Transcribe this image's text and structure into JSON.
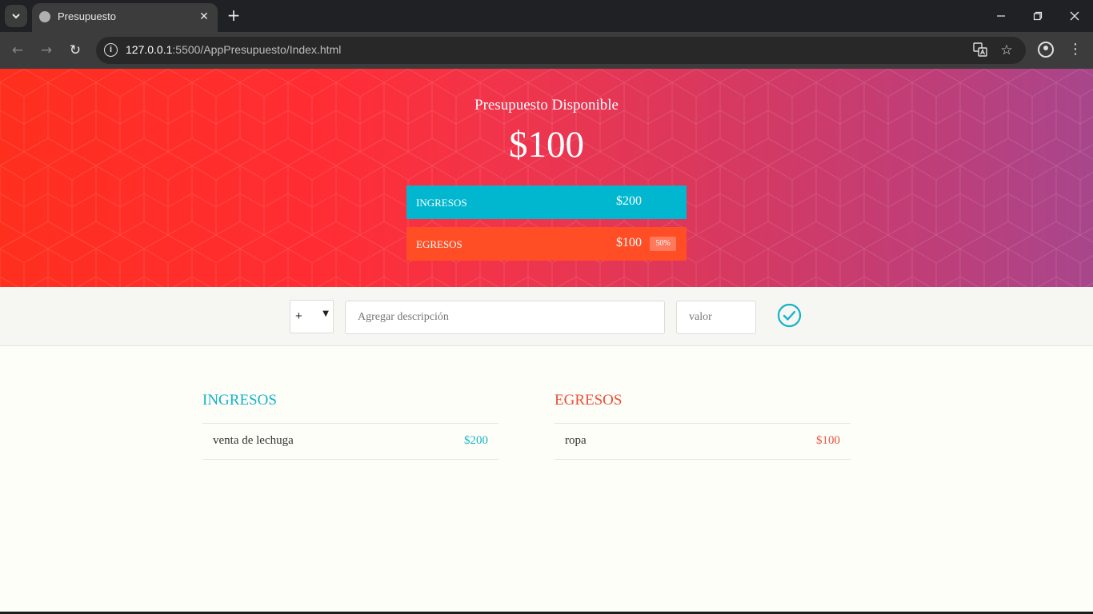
{
  "browser": {
    "tab_title": "Presupuesto",
    "url_host": "127.0.0.1",
    "url_rest": ":5500/AppPresupuesto/Index.html",
    "icons": [
      "tab-search-icon",
      "globe-icon",
      "close-icon",
      "plus-icon",
      "minimize-icon",
      "restore-icon",
      "close-window-icon",
      "back-arrow-icon",
      "forward-arrow-icon",
      "reload-icon",
      "info-icon",
      "translate-icon",
      "star-icon",
      "profile-icon",
      "kebab-menu-icon"
    ]
  },
  "header": {
    "title": "Presupuesto Disponible",
    "available": "$100",
    "income_label": "INGRESOS",
    "income_total": "$200",
    "expense_label": "EGRESOS",
    "expense_total": "$100",
    "expense_percentage": "50%",
    "colors": {
      "income": "#00b7cf",
      "expense": "#ff4e26",
      "gradient_start": "#ff2f1e",
      "gradient_end": "#a8468c"
    }
  },
  "form": {
    "type_value": "+",
    "description_placeholder": "Agregar descripción",
    "value_placeholder": "valor",
    "submit_icon": "check-circle-icon"
  },
  "lists": {
    "income": {
      "title": "INGRESOS",
      "items": [
        {
          "description": "venta de lechuga",
          "value": "$200"
        }
      ]
    },
    "expense": {
      "title": "EGRESOS",
      "items": [
        {
          "description": "ropa",
          "value": "$100"
        }
      ]
    }
  }
}
